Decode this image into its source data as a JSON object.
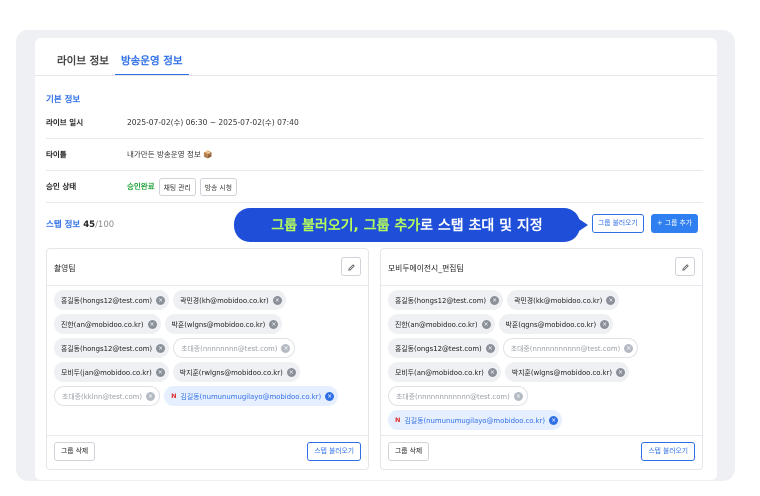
{
  "tabs": [
    {
      "label": "라이브 정보"
    },
    {
      "label": "방송운영 정보"
    }
  ],
  "basic": {
    "title": "기본 정보",
    "live_date_label": "라이브 일시",
    "live_date_value": "2025-07-02(수) 06:30 ~ 2025-07-02(수) 07:40",
    "title_label": "타이틀",
    "title_value": "내가만든 방송운영 정보 📦",
    "approval_label": "승인 상태",
    "approval_value": "승인완료",
    "chat_btn": "채팅 관리",
    "watch_btn": "방송 시청"
  },
  "staff": {
    "label": "스탭 정보",
    "count": "45",
    "total": "/100",
    "load_group_btn": "그룹 불러오기",
    "add_group_btn": "+ 그룹 추가"
  },
  "callout": {
    "part1": "그룹 불러오기, 그룹 추가",
    "part2": "로 스탭 초대 및 지정"
  },
  "groups": [
    {
      "name": "촬영팀",
      "delete_btn": "그룹 삭제",
      "load_staff_btn": "스텝 불러오기",
      "members": [
        {
          "text": "홍길동(hongs12@test.com)",
          "style": "normal"
        },
        {
          "text": "곽민경(kh@mobidoo.co.kr)",
          "style": "normal"
        },
        {
          "text": "진한(an@mobidoo.co.kr)",
          "style": "normal"
        },
        {
          "text": "박훈(wlgns@mobidoo.co.kr)",
          "style": "normal"
        },
        {
          "text": "홍길동(hongs12@test.com)",
          "style": "normal"
        },
        {
          "text": "초대중(nnnnnnnn@test.com)",
          "style": "ghost"
        },
        {
          "text": "모비두(jan@mobidoo.co.kr)",
          "style": "normal"
        },
        {
          "text": "박지훈(rwlgns@mobidoo.co.kr)",
          "style": "normal"
        },
        {
          "text": "초대중(kklnn@test.com)",
          "style": "ghost"
        },
        {
          "text": "김길동(numunumugilayo@mobidoo.co.kr)",
          "style": "sel",
          "mark": "N"
        }
      ]
    },
    {
      "name": "모비두에이전시_편집팀",
      "delete_btn": "그룹 삭제",
      "load_staff_btn": "스텝 불러오기",
      "members": [
        {
          "text": "홍길동(hongs12@test.com)",
          "style": "normal"
        },
        {
          "text": "곽민경(kk@mobidoo.co.kr)",
          "style": "normal"
        },
        {
          "text": "진한(an@mobidoo.co.kr)",
          "style": "normal"
        },
        {
          "text": "박훈(qgns@mobidoo.co.kr)",
          "style": "normal"
        },
        {
          "text": "홍길동(ongs12@test.com)",
          "style": "normal"
        },
        {
          "text": "초대중(nnnnnnnnnnn@test.com)",
          "style": "ghost"
        },
        {
          "text": "모비두(an@mobidoo.co.kr)",
          "style": "normal"
        },
        {
          "text": "박지훈(wlgns@mobidoo.co.kr)",
          "style": "normal"
        },
        {
          "text": "초대중(nnnnnnnnnnnn@test.com)",
          "style": "ghost"
        },
        {
          "text": "김길동(numunumugilayo@mobidoo.co.kr)",
          "style": "sel",
          "mark": "N"
        }
      ]
    }
  ],
  "icons": {
    "edit": "pencil-icon",
    "remove": "close-circle-icon"
  },
  "colors": {
    "accent": "#2f6fe6",
    "callout_bg": "#1f4fd8",
    "callout_highlight": "#b7ff5a",
    "approved": "#22a33a"
  }
}
